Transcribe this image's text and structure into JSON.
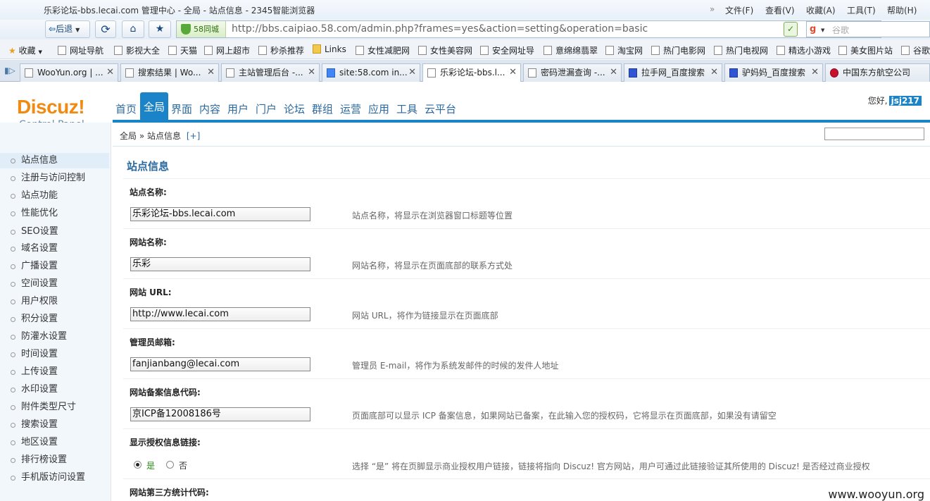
{
  "browser": {
    "title": "乐彩论坛-bbs.lecai.com 管理中心 - 全局 - 站点信息 - 2345智能浏览器",
    "menu": [
      "文件(F)",
      "查看(V)",
      "收藏(A)",
      "工具(T)",
      "帮助(H)"
    ],
    "back_label": "后退",
    "secure_label": "58同城",
    "url": "http://bbs.caipiao.58.com/admin.php?frames=yes&action=setting&operation=basic",
    "search_placeholder": "谷歌"
  },
  "bookmarks": [
    "收藏",
    "网址导航",
    "影视大全",
    "天猫",
    "网上超市",
    "秒杀推荐",
    "Links",
    "女性减肥网",
    "女性美容网",
    "安全网址导",
    "意绵绵翡翠",
    "淘宝网",
    "热门电影网",
    "热门电视网",
    "精选小游戏",
    "美女图片站",
    "谷歌"
  ],
  "tabs": [
    {
      "label": "WooYun.org | ..."
    },
    {
      "label": "搜索结果 | Wo..."
    },
    {
      "label": "主站管理后台 -..."
    },
    {
      "label": "site:58.com in..."
    },
    {
      "label": "乐彩论坛-bbs.l..."
    },
    {
      "label": "密码泄漏查询 -..."
    },
    {
      "label": "拉手网_百度搜索"
    },
    {
      "label": "驴妈妈_百度搜索"
    },
    {
      "label": "中国东方航空公司"
    }
  ],
  "header": {
    "logo": "Discuz!",
    "logo_sub": "Control Panel",
    "nav": [
      "首页",
      "全局",
      "界面",
      "内容",
      "用户",
      "门户",
      "论坛",
      "群组",
      "运营",
      "应用",
      "工具",
      "云平台"
    ],
    "greeting": "您好,",
    "username": "jsj217"
  },
  "breadcrumb": {
    "root": "全局",
    "sep": "»",
    "current": "站点信息",
    "add": "[+]"
  },
  "sidebar": [
    "站点信息",
    "注册与访问控制",
    "站点功能",
    "性能优化",
    "SEO设置",
    "域名设置",
    "广播设置",
    "空间设置",
    "用户权限",
    "积分设置",
    "防灌水设置",
    "时间设置",
    "上传设置",
    "水印设置",
    "附件类型尺寸",
    "搜索设置",
    "地区设置",
    "排行榜设置",
    "手机版访问设置"
  ],
  "main": {
    "title": "站点信息",
    "fields": [
      {
        "label": "站点名称:",
        "value": "乐彩论坛-bbs.lecai.com",
        "help": "站点名称，将显示在浏览器窗口标题等位置"
      },
      {
        "label": "网站名称:",
        "value": "乐彩",
        "help": "网站名称，将显示在页面底部的联系方式处"
      },
      {
        "label": "网站 URL:",
        "value": "http://www.lecai.com",
        "help": "网站 URL，将作为链接显示在页面底部"
      },
      {
        "label": "管理员邮箱:",
        "value": "fanjianbang@lecai.com",
        "help": "管理员 E-mail，将作为系统发邮件的时候的发件人地址"
      },
      {
        "label": "网站备案信息代码:",
        "value": "京ICP备12008186号",
        "help": "页面底部可以显示 ICP 备案信息，如果网站已备案，在此输入您的授权码，它将显示在页面底部，如果没有请留空"
      }
    ],
    "license": {
      "label": "显示授权信息链接:",
      "yes": "是",
      "no": "否",
      "help": "选择 “是” 将在页脚显示商业授权用户链接，链接将指向 Discuz! 官方网站，用户可通过此链接验证其所使用的 Discuz! 是否经过商业授权"
    },
    "stats_label": "网站第三方统计代码:"
  },
  "watermark": "www.wooyun.org"
}
